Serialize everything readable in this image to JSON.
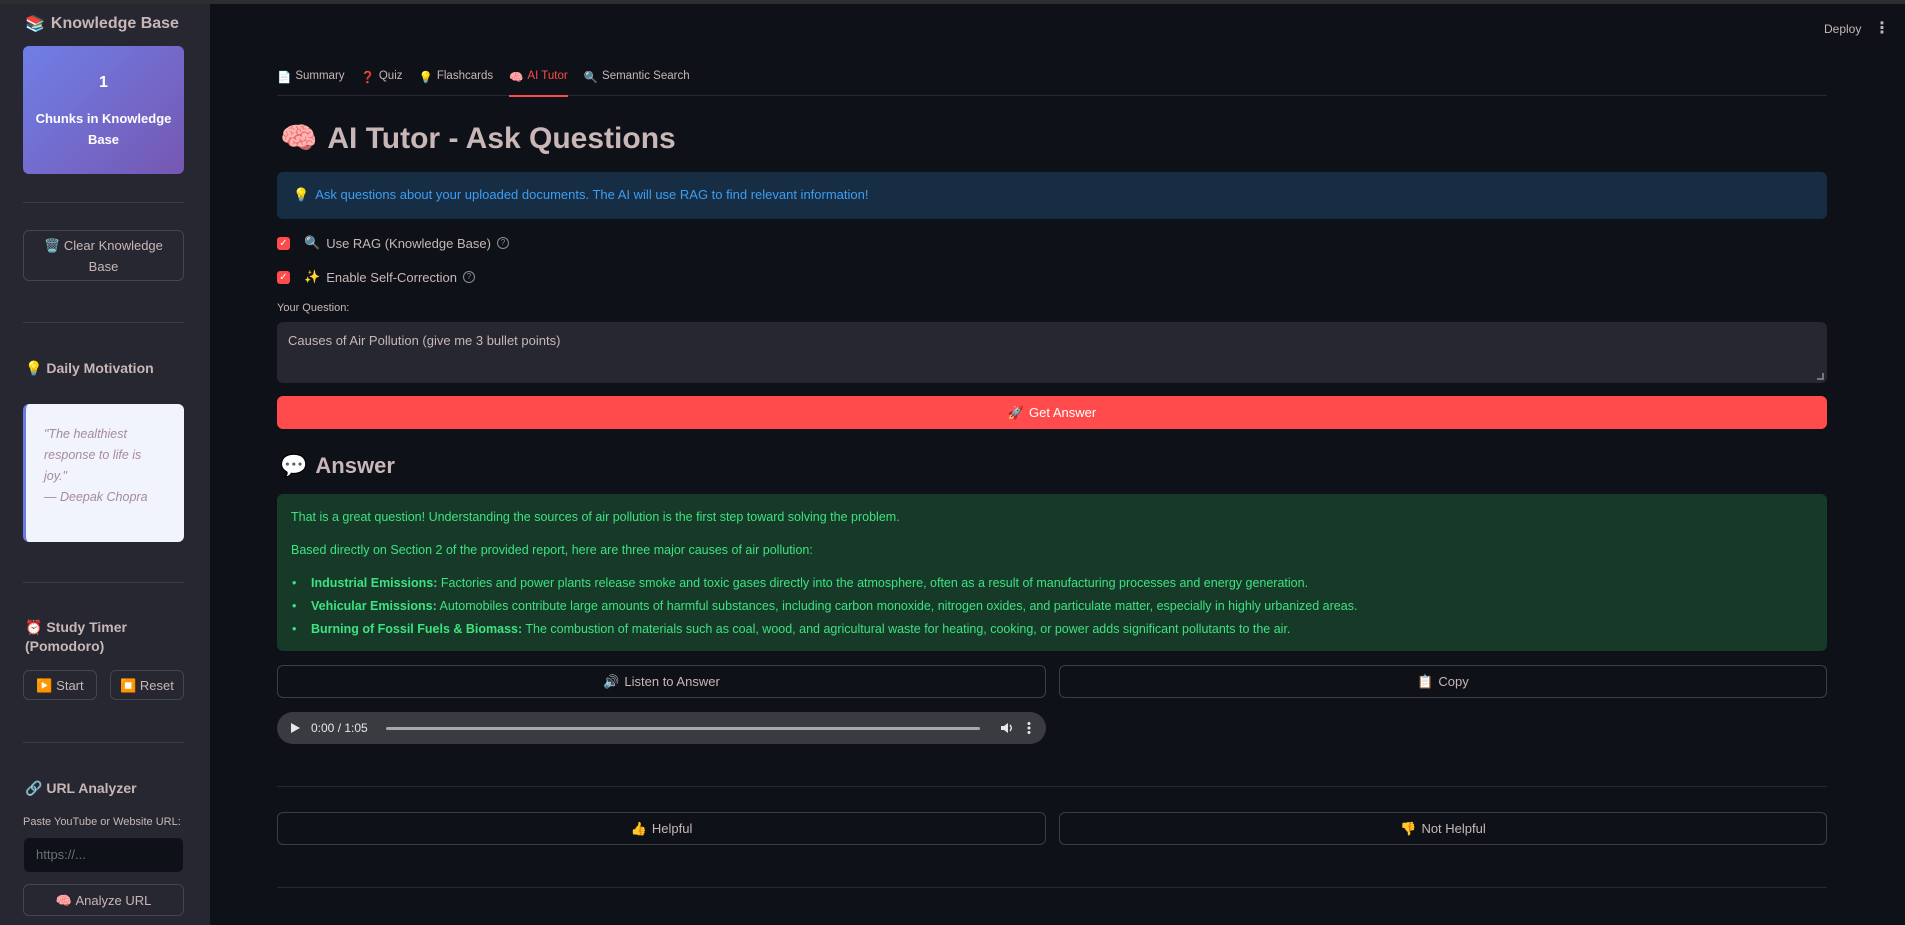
{
  "sidebar": {
    "title_icon": "📚",
    "title": "Knowledge Base",
    "metric_value": "1",
    "metric_label": "Chunks in Knowledge Base",
    "clear_icon": "🗑️",
    "clear_label": "Clear Knowledge Base",
    "motivation_icon": "💡",
    "motivation_heading": "Daily Motivation",
    "quote_text": "\"The healthiest response to life is joy.\"",
    "quote_author": "— Deepak Chopra",
    "timer_icon": "⏰",
    "timer_heading": "Study Timer (Pomodoro)",
    "start_icon": "▶️",
    "start_label": "Start",
    "reset_icon": "⏹️",
    "reset_label": "Reset",
    "url_icon": "🔗",
    "url_heading": "URL Analyzer",
    "url_field_label": "Paste YouTube or Website URL:",
    "url_placeholder": "https://...",
    "analyze_icon": "🧠",
    "analyze_label": "Analyze URL"
  },
  "header": {
    "deploy_label": "Deploy",
    "menu_icon": "⋮"
  },
  "tabs": [
    {
      "icon": "📄",
      "label": "Summary"
    },
    {
      "icon": "❓",
      "label": "Quiz"
    },
    {
      "icon": "💡",
      "label": "Flashcards"
    },
    {
      "icon": "🧠",
      "label": "AI Tutor"
    },
    {
      "icon": "🔍",
      "label": "Semantic Search"
    }
  ],
  "main": {
    "title_icon": "🧠",
    "title": "AI Tutor - Ask Questions",
    "info_icon": "💡",
    "info_text": "Ask questions about your uploaded documents. The AI will use RAG to find relevant information!",
    "rag_icon": "🔍",
    "rag_label": "Use RAG (Knowledge Base)",
    "selfcorrect_icon": "✨",
    "selfcorrect_label": "Enable Self-Correction",
    "question_label": "Your Question:",
    "question_value": "Causes of Air Pollution (give me 3 bullet points)",
    "get_answer_icon": "🚀",
    "get_answer_label": "Get Answer",
    "answer_icon": "💬",
    "answer_heading": "Answer",
    "answer_intro": "That is a great question! Understanding the sources of air pollution is the first step toward solving the problem.",
    "answer_lead": "Based directly on Section 2 of the provided report, here are three major causes of air pollution:",
    "answer_points": [
      {
        "title": "Industrial Emissions:",
        "text": " Factories and power plants release smoke and toxic gases directly into the atmosphere, often as a result of manufacturing processes and energy generation."
      },
      {
        "title": "Vehicular Emissions:",
        "text": " Automobiles contribute large amounts of harmful substances, including carbon monoxide, nitrogen oxides, and particulate matter, especially in highly urbanized areas."
      },
      {
        "title": "Burning of Fossil Fuels & Biomass:",
        "text": " The combustion of materials such as coal, wood, and agricultural waste for heating, cooking, or power adds significant pollutants to the air."
      }
    ],
    "listen_icon": "🔊",
    "listen_label": "Listen to Answer",
    "copy_icon": "📋",
    "copy_label": "Copy",
    "audio_time": "0:00 / 1:05",
    "helpful_icon": "👍",
    "helpful_label": "Helpful",
    "not_helpful_icon": "👎",
    "not_helpful_label": "Not Helpful"
  },
  "colors": {
    "accent": "#ff4b4b",
    "bg": "#0e1117",
    "sidebar": "#262730",
    "info_bg": "#172d43",
    "success_bg": "#173928"
  }
}
